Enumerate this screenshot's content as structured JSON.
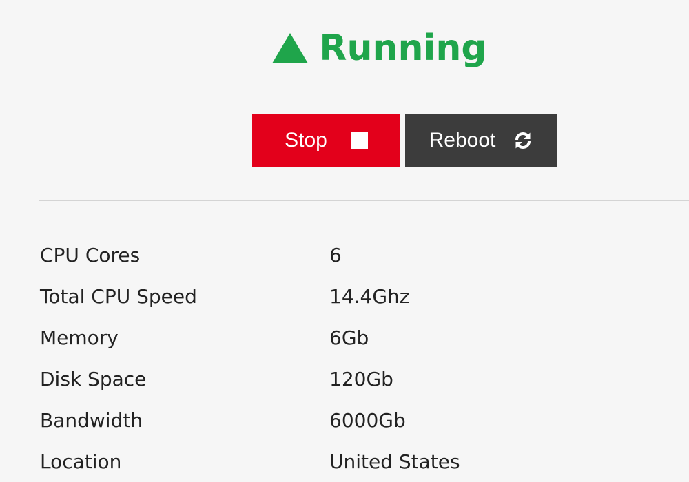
{
  "status": {
    "text": "Running",
    "icon": "triangle-up-icon",
    "color": "#1fa54b"
  },
  "actions": {
    "stop_label": "Stop",
    "stop_icon": "stop-square-icon",
    "stop_color": "#e3001b",
    "reboot_label": "Reboot",
    "reboot_icon": "refresh-icon",
    "reboot_color": "#3c3c3c"
  },
  "specs": [
    {
      "label": "CPU Cores",
      "value": "6"
    },
    {
      "label": "Total CPU Speed",
      "value": "14.4Ghz"
    },
    {
      "label": "Memory",
      "value": "6Gb"
    },
    {
      "label": "Disk Space",
      "value": "120Gb"
    },
    {
      "label": "Bandwidth",
      "value": "6000Gb"
    },
    {
      "label": "Location",
      "value": "United States"
    }
  ]
}
